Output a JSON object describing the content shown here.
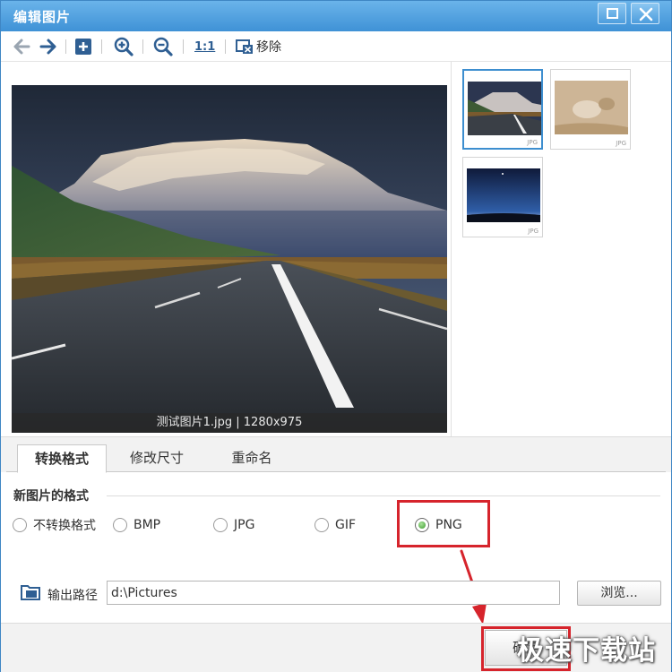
{
  "window": {
    "title": "编辑图片"
  },
  "toolbar": {
    "zoom_1to1_label": "1:1",
    "remove_label": "移除"
  },
  "preview": {
    "caption": "测试图片1.jpg | 1280x975"
  },
  "thumbnails": [
    {
      "format": "JPG",
      "selected": true
    },
    {
      "format": "JPG",
      "selected": false
    },
    {
      "format": "JPG",
      "selected": false
    }
  ],
  "tabs": [
    {
      "label": "转换格式",
      "active": true
    },
    {
      "label": "修改尺寸",
      "active": false
    },
    {
      "label": "重命名",
      "active": false
    }
  ],
  "format_section": {
    "heading": "新图片的格式",
    "options": [
      {
        "label": "不转换格式",
        "checked": false
      },
      {
        "label": "BMP",
        "checked": false
      },
      {
        "label": "JPG",
        "checked": false
      },
      {
        "label": "GIF",
        "checked": false
      },
      {
        "label": "PNG",
        "checked": true
      }
    ]
  },
  "output": {
    "label": "输出路径",
    "path": "d:\\Pictures",
    "browse_label": "浏览..."
  },
  "footer": {
    "ok_label": "确定"
  },
  "watermark": {
    "text": "极速下载站"
  },
  "colors": {
    "titlebar": "#4a9de0",
    "selected_border": "#3d8ecf",
    "highlight": "#d6242c",
    "radio_checked": "#3d9a2e"
  }
}
